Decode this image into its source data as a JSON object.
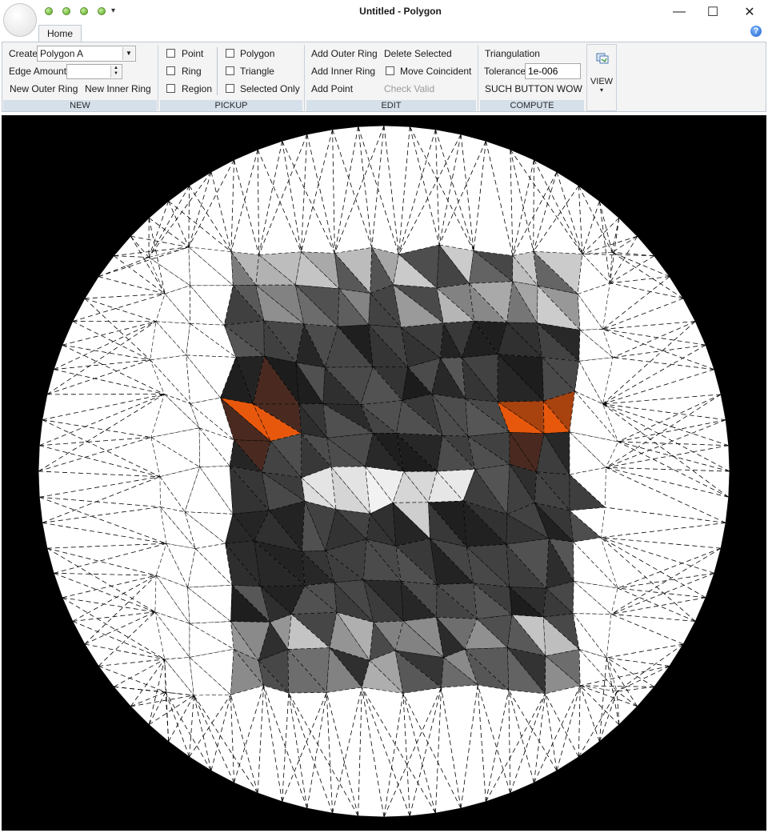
{
  "window": {
    "title": "Untitled - Polygon",
    "minimize_glyph": "—",
    "maximize_glyph": "☐",
    "close_glyph": "✕"
  },
  "quick_access": {
    "dropdown_glyph": "▾"
  },
  "tabs": [
    {
      "label": "Home"
    }
  ],
  "help": {
    "glyph": "?"
  },
  "ribbon": {
    "new": {
      "caption": "NEW",
      "create_label": "Create",
      "create_value": "Polygon A",
      "edge_amount_label": "Edge Amount",
      "edge_amount_value": "",
      "new_outer_ring": "New Outer Ring",
      "new_inner_ring": "New Inner Ring"
    },
    "pickup": {
      "caption": "PICKUP",
      "point": "Point",
      "ring": "Ring",
      "region": "Region",
      "polygon": "Polygon",
      "triangle": "Triangle",
      "selected_only": "Selected Only"
    },
    "edit": {
      "caption": "EDIT",
      "add_outer_ring": "Add Outer Ring",
      "add_inner_ring": "Add Inner Ring",
      "add_point": "Add Point",
      "delete_selected": "Delete Selected",
      "move_coincident": "Move Coincident",
      "check_valid": "Check Valid"
    },
    "compute": {
      "caption": "COMPUTE",
      "triangulation": "Triangulation",
      "tolerance_label": "Tolerance",
      "tolerance_value": "1e-006",
      "such_button": "SUCH BUTTON WOW"
    },
    "view": {
      "label": "VIEW",
      "glyph": "▾"
    }
  },
  "colors": {
    "background": "#000000",
    "disk": "#ffffff",
    "orange": "#e8580c",
    "dark": "#232325"
  },
  "icons": [
    "app-orb-icon",
    "qat-dot-icon",
    "chevron-down-icon",
    "help-icon",
    "view-icon"
  ]
}
